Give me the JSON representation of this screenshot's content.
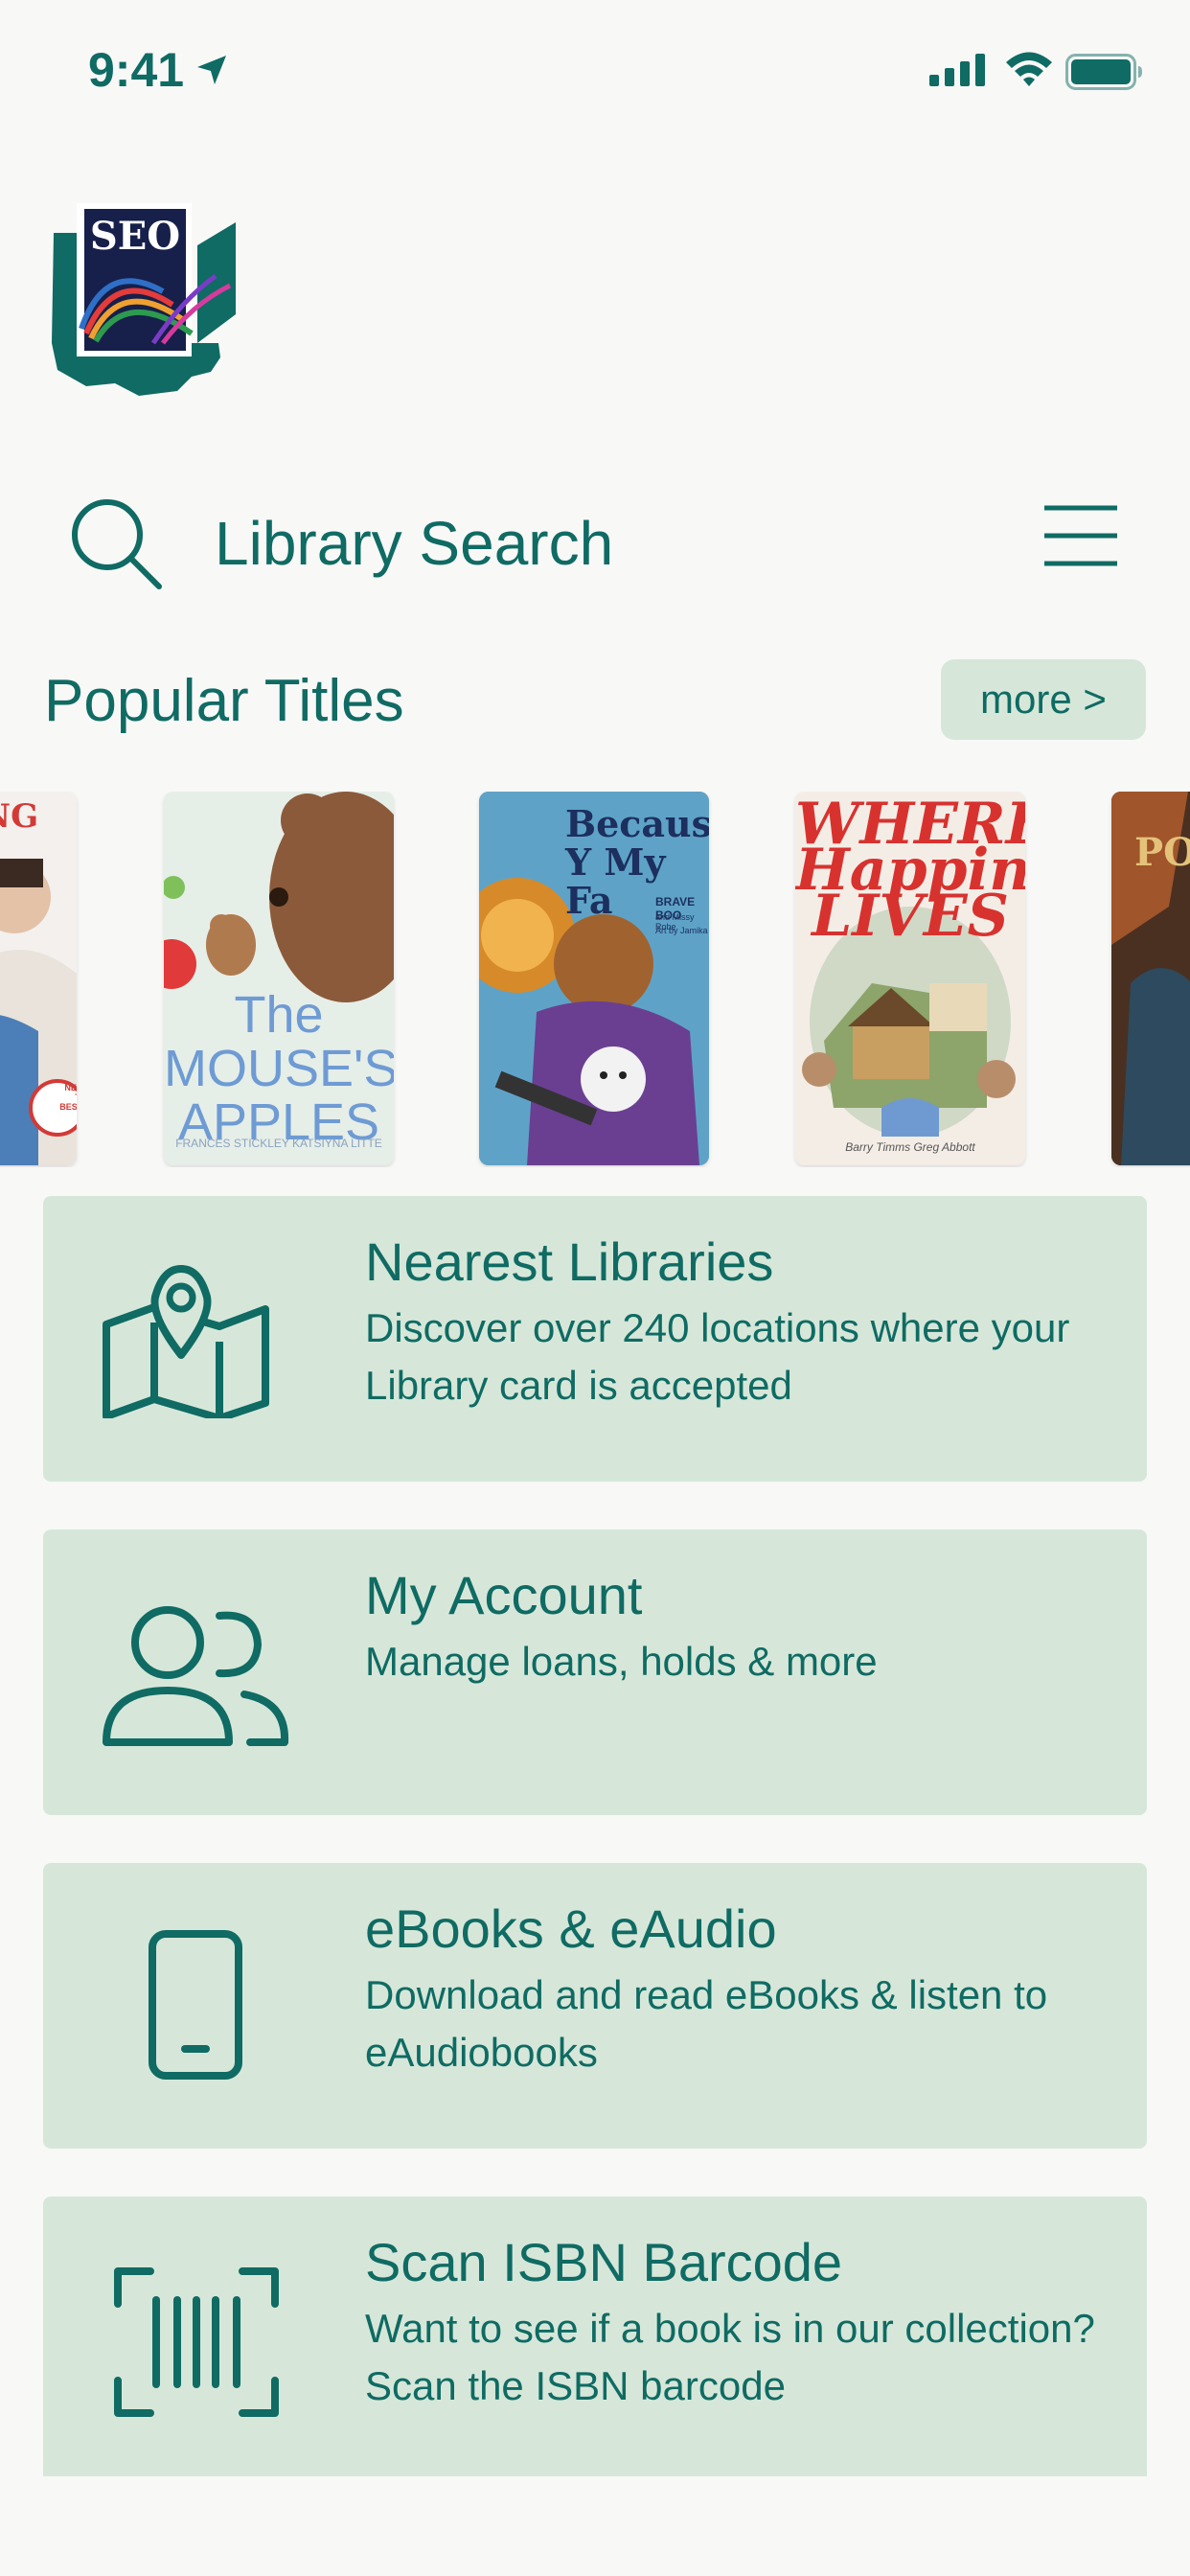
{
  "status_bar": {
    "time": "9:41",
    "icons": [
      "location-arrow-icon",
      "cellular-signal-icon",
      "wifi-icon",
      "battery-icon"
    ]
  },
  "logo": {
    "text": "SEO"
  },
  "search": {
    "label": "Library Search"
  },
  "popular": {
    "title": "Popular Titles",
    "more_label": "more >",
    "books": [
      {
        "title_fragment": "NG",
        "badge": "NEW YORK TIMES BESTSELLER"
      },
      {
        "title": "The MOUSE'S APPLES",
        "authors": "FRANCES STICKLEY   KATSIYNA LITTE"
      },
      {
        "title": "Because Y My Fa",
        "subtitle": "BRAVE BOO",
        "credits": "and Missy Robe",
        "art": "Art by Jamika"
      },
      {
        "title": "WHERE Happines LIVES",
        "authors": "Barry Timms   Greg Abbott"
      },
      {
        "title": "PO"
      }
    ]
  },
  "cards": [
    {
      "title": "Nearest Libraries",
      "desc": "Discover over 240 locations where your Library card is accepted",
      "icon": "map-pin-icon"
    },
    {
      "title": "My Account",
      "desc": "Manage loans, holds & more",
      "icon": "users-icon"
    },
    {
      "title": "eBooks & eAudio",
      "desc": "Download and read eBooks & listen to eAudiobooks",
      "icon": "phone-icon"
    },
    {
      "title": "Scan ISBN Barcode",
      "desc": "Want to see if a book is in our collection? Scan the ISBN barcode",
      "icon": "barcode-scan-icon"
    }
  ],
  "colors": {
    "accent": "#0f6b63",
    "card_background": "#d6e7d9",
    "page_background": "#f8f8f7"
  }
}
